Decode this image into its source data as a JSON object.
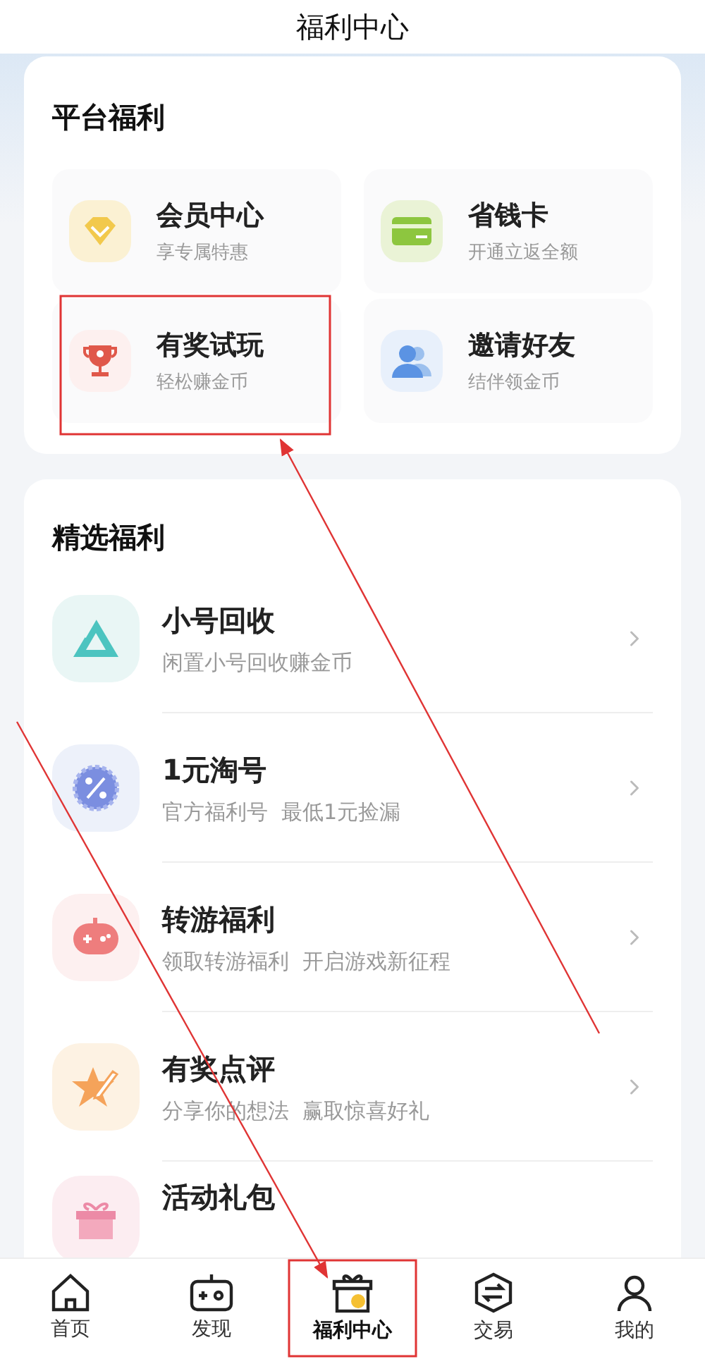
{
  "title": "福利中心",
  "platform": {
    "heading": "平台福利",
    "tiles": [
      {
        "title": "会员中心",
        "subtitle": "享专属特惠",
        "kind": "diamond"
      },
      {
        "title": "省钱卡",
        "subtitle": "开通立返全额",
        "kind": "card"
      },
      {
        "title": "有奖试玩",
        "subtitle": "轻松赚金币",
        "kind": "trophy"
      },
      {
        "title": "邀请好友",
        "subtitle": "结伴领金币",
        "kind": "friends"
      }
    ]
  },
  "featured": {
    "heading": "精选福利",
    "items": [
      {
        "title": "小号回收",
        "subtitle": "闲置小号回收赚金币",
        "kind": "recycle"
      },
      {
        "title": "1元淘号",
        "subtitle": "官方福利号  最低1元捡漏",
        "kind": "discount"
      },
      {
        "title": "转游福利",
        "subtitle": "领取转游福利  开启游戏新征程",
        "kind": "gamepad"
      },
      {
        "title": "有奖点评",
        "subtitle": "分享你的想法  赢取惊喜好礼",
        "kind": "star"
      },
      {
        "title": "活动礼包",
        "kind": "gift"
      }
    ]
  },
  "nav": [
    {
      "label": "首页",
      "selected": false,
      "kind": "home"
    },
    {
      "label": "发现",
      "selected": false,
      "kind": "controller"
    },
    {
      "label": "福利中心",
      "selected": true,
      "kind": "giftbox"
    },
    {
      "label": "交易",
      "selected": false,
      "kind": "exchange"
    },
    {
      "label": "我的",
      "selected": false,
      "kind": "profile"
    }
  ]
}
